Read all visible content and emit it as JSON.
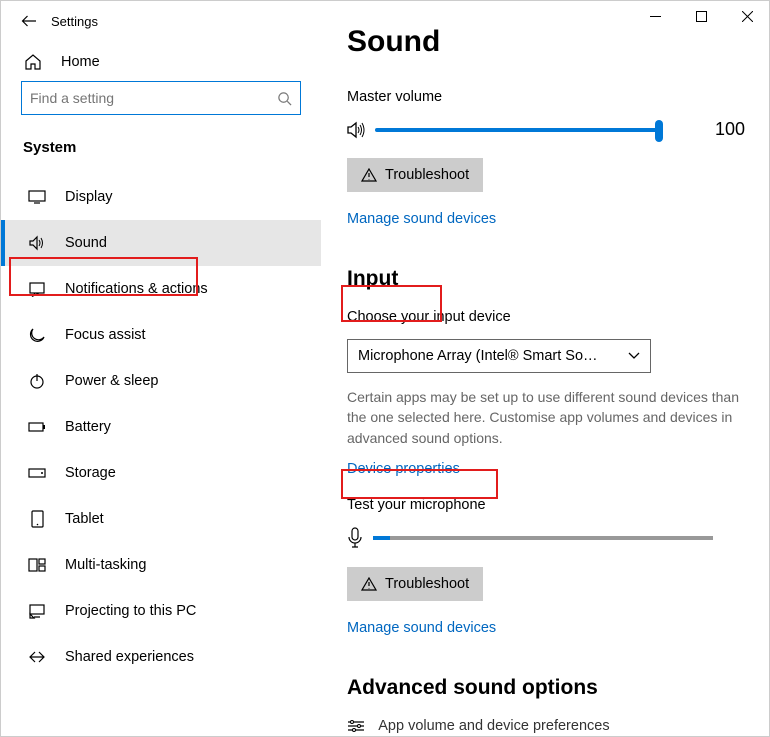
{
  "window": {
    "title": "Settings"
  },
  "sidebar": {
    "home": "Home",
    "search_placeholder": "Find a setting",
    "category": "System",
    "items": [
      {
        "label": "Display"
      },
      {
        "label": "Sound"
      },
      {
        "label": "Notifications & actions"
      },
      {
        "label": "Focus assist"
      },
      {
        "label": "Power & sleep"
      },
      {
        "label": "Battery"
      },
      {
        "label": "Storage"
      },
      {
        "label": "Tablet"
      },
      {
        "label": "Multi-tasking"
      },
      {
        "label": "Projecting to this PC"
      },
      {
        "label": "Shared experiences"
      }
    ]
  },
  "main": {
    "title": "Sound",
    "master_volume_label": "Master volume",
    "master_volume_value": "100",
    "troubleshoot_output": "Troubleshoot",
    "manage_devices_output": "Manage sound devices",
    "input_heading": "Input",
    "choose_input_label": "Choose your input device",
    "input_device_selected": "Microphone Array (Intel® Smart So…",
    "input_help": "Certain apps may be set up to use different sound devices than the one selected here. Customise app volumes and devices in advanced sound options.",
    "device_properties": "Device properties",
    "test_mic_label": "Test your microphone",
    "troubleshoot_input": "Troubleshoot",
    "manage_devices_input": "Manage sound devices",
    "advanced_heading": "Advanced sound options",
    "advanced_item": "App volume and device preferences"
  }
}
